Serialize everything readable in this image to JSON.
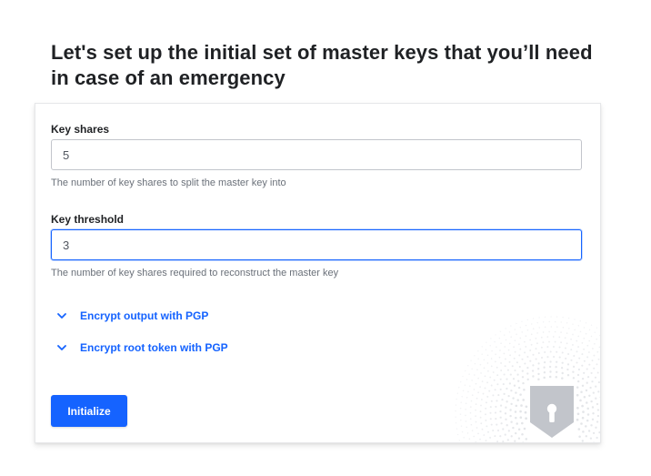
{
  "heading": "Let's set up the initial set of master keys that you’ll need in case of an emergency",
  "form": {
    "key_shares": {
      "label": "Key shares",
      "value": "5",
      "help": "The number of key shares to split the master key into"
    },
    "key_threshold": {
      "label": "Key threshold",
      "value": "3",
      "help": "The number of key shares required to reconstruct the master key"
    },
    "toggles": {
      "pgp_output": "Encrypt output with PGP",
      "pgp_root_token": "Encrypt root token with PGP"
    },
    "submit_label": "Initialize"
  },
  "icons": {
    "toggle": "chevron-down-icon",
    "decoration": "keyhole-shield-icon"
  },
  "colors": {
    "accent": "#1563ff",
    "text": "#1f2124",
    "muted": "#6a7079",
    "shield": "#c2c5cb"
  }
}
